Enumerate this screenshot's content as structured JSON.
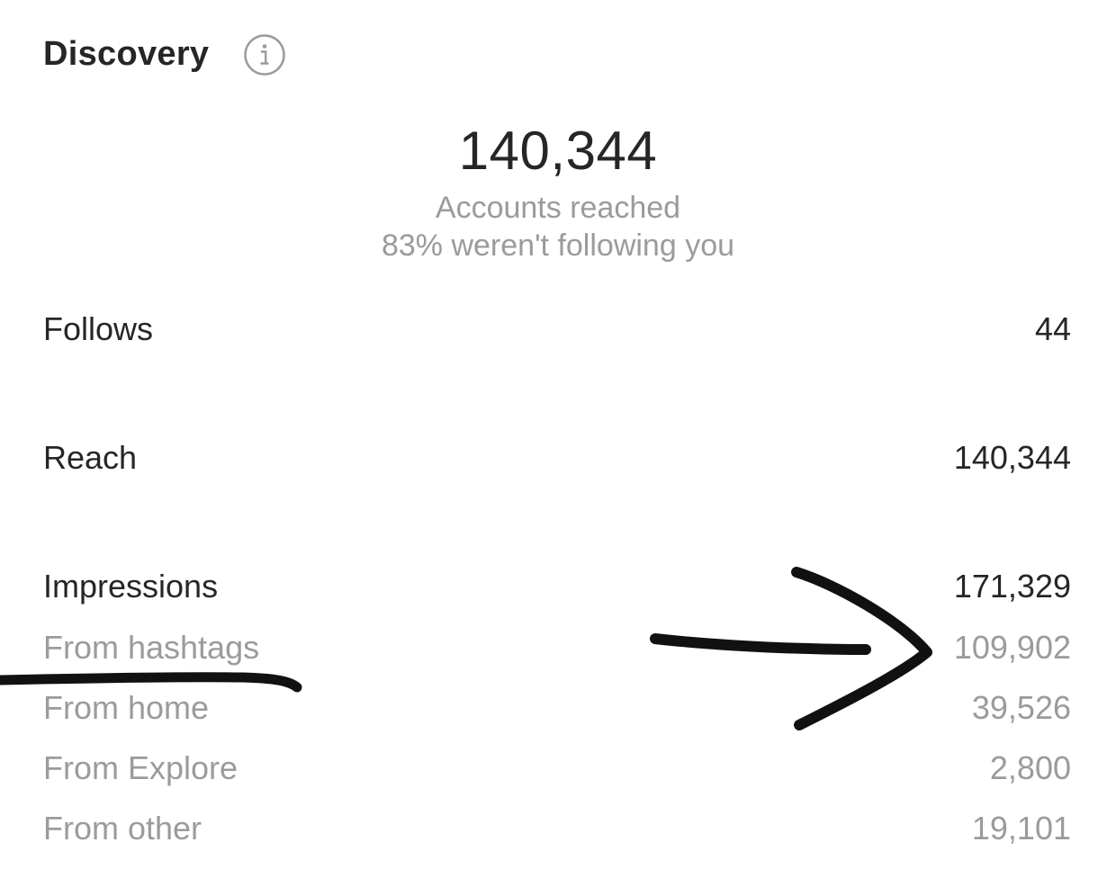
{
  "discovery": {
    "title": "Discovery",
    "info_icon": "info-icon"
  },
  "summary": {
    "value": "140,344",
    "label": "Accounts reached",
    "sub_label": "83% weren't following you"
  },
  "metrics": [
    {
      "label": "Follows",
      "value": "44"
    },
    {
      "label": "Reach",
      "value": "140,344"
    },
    {
      "label": "Impressions",
      "value": "171,329"
    }
  ],
  "impression_sources": [
    {
      "label": "From hashtags",
      "value": "109,902"
    },
    {
      "label": "From home",
      "value": "39,526"
    },
    {
      "label": "From Explore",
      "value": "2,800"
    },
    {
      "label": "From other",
      "value": "19,101"
    }
  ],
  "annotation": {
    "underline": "handwritten-underline",
    "arrow": "handwritten-arrow",
    "ink_color": "#111111"
  }
}
